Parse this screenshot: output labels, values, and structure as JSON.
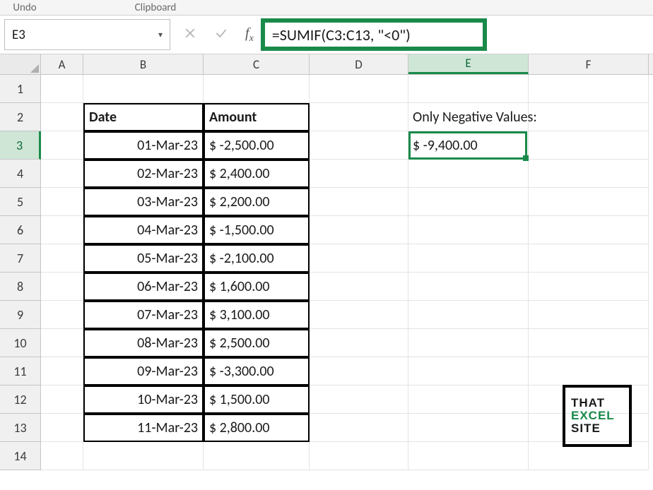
{
  "ribbon": {
    "undo": "Undo",
    "clipboard": "Clipboard"
  },
  "name_box": "E3",
  "formula": "=SUMIF(C3:C13, \"<0\")",
  "columns": [
    "A",
    "B",
    "C",
    "D",
    "E",
    "F"
  ],
  "row_headers": [
    1,
    2,
    3,
    4,
    5,
    6,
    7,
    8,
    9,
    10,
    11,
    12,
    13,
    14
  ],
  "table": {
    "headers": {
      "date": "Date",
      "amount": "Amount"
    },
    "rows": [
      {
        "date": "01-Mar-23",
        "amount": "$ -2,500.00"
      },
      {
        "date": "02-Mar-23",
        "amount": "$  2,400.00"
      },
      {
        "date": "03-Mar-23",
        "amount": "$  2,200.00"
      },
      {
        "date": "04-Mar-23",
        "amount": "$ -1,500.00"
      },
      {
        "date": "05-Mar-23",
        "amount": "$ -2,100.00"
      },
      {
        "date": "06-Mar-23",
        "amount": "$  1,600.00"
      },
      {
        "date": "07-Mar-23",
        "amount": "$  3,100.00"
      },
      {
        "date": "08-Mar-23",
        "amount": "$  2,500.00"
      },
      {
        "date": "09-Mar-23",
        "amount": "$ -3,300.00"
      },
      {
        "date": "10-Mar-23",
        "amount": "$  1,500.00"
      },
      {
        "date": "11-Mar-23",
        "amount": "$  2,800.00"
      }
    ]
  },
  "result": {
    "label": "Only Negative Values:",
    "value": "$  -9,400.00"
  },
  "watermark": {
    "l1": "THAT",
    "l2": "EXCEL",
    "l3": "SITE"
  }
}
